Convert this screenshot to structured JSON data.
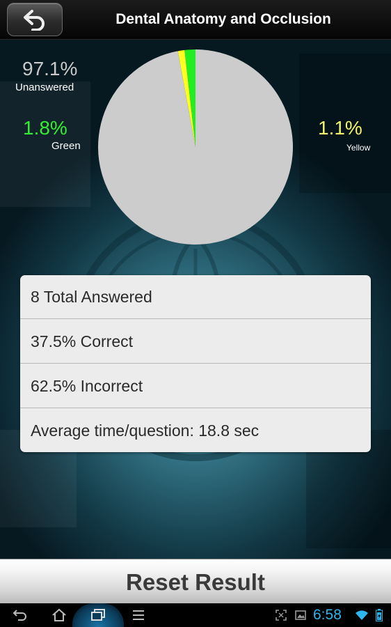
{
  "title_bar": {
    "title": "Dental Anatomy and Occlusion",
    "back_icon": "back-arrow-icon"
  },
  "legend": {
    "unanswered": {
      "value": "97.1%",
      "label": "Unanswered",
      "color": "#c9c9c9"
    },
    "green": {
      "value": "1.8%",
      "label": "Green",
      "color": "#33ee33"
    },
    "yellow": {
      "value": "1.1%",
      "label": "Yellow",
      "color": "#f2f26a"
    }
  },
  "chart_data": {
    "type": "pie",
    "slices": [
      {
        "name": "Green",
        "value": 1.8,
        "color": "#22ee22"
      },
      {
        "name": "Yellow",
        "value": 1.1,
        "color": "#ffff22"
      },
      {
        "name": "Unanswered",
        "value": 97.1,
        "color": "#cccccc"
      }
    ]
  },
  "stats": [
    {
      "text": "8 Total Answered"
    },
    {
      "text": "37.5% Correct"
    },
    {
      "text": "62.5% Incorrect"
    },
    {
      "text": "Average time/question: 18.8 sec"
    }
  ],
  "reset_button": {
    "label": "Reset Result"
  },
  "system_bar": {
    "time": "6:58",
    "nav_icons": [
      "back-icon",
      "home-icon",
      "recent-apps-icon",
      "menu-icon"
    ],
    "status_icons": [
      "screenshot-icon",
      "gallery-icon",
      "wifi-icon",
      "battery-icon"
    ]
  },
  "colors": {
    "background_accent": "#2f6d7e",
    "clock": "#2fb5ee"
  }
}
